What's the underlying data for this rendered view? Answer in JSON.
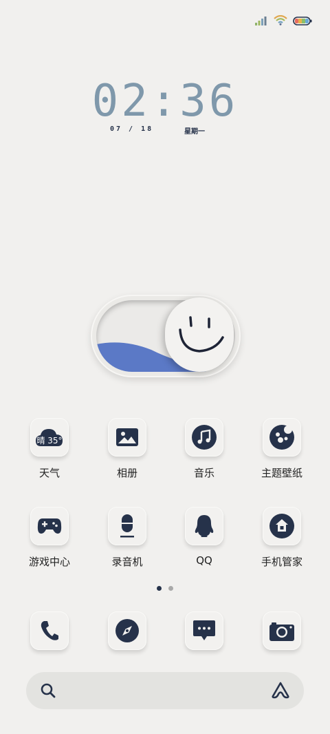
{
  "status_bar": {
    "icons": [
      "signal-icon",
      "wifi-icon",
      "battery-icon"
    ]
  },
  "clock": {
    "time": "02:36",
    "date": "07 / 18",
    "weekday": "星期一"
  },
  "widget": {
    "icons": [
      "smiley-face-icon"
    ],
    "toggle_state": "on",
    "colors": {
      "wave": "#5b79c6",
      "knob": "#f3f2f0"
    }
  },
  "apps_row1": [
    {
      "label": "天气",
      "icon": "weather-cloud-icon",
      "weather_text": "晴 35°"
    },
    {
      "label": "相册",
      "icon": "gallery-image-icon"
    },
    {
      "label": "音乐",
      "icon": "music-note-icon"
    },
    {
      "label": "主题壁纸",
      "icon": "theme-palette-icon"
    }
  ],
  "apps_row2": [
    {
      "label": "游戏中心",
      "icon": "gamepad-icon"
    },
    {
      "label": "录音机",
      "icon": "microphone-icon"
    },
    {
      "label": "QQ",
      "icon": "qq-penguin-icon"
    },
    {
      "label": "手机管家",
      "icon": "phone-manager-icon"
    }
  ],
  "page_indicator": {
    "pages": 2,
    "current": 1
  },
  "dock": [
    {
      "icon": "phone-icon"
    },
    {
      "icon": "compass-browser-icon"
    },
    {
      "icon": "message-icon"
    },
    {
      "icon": "camera-icon"
    }
  ],
  "search_bar": {
    "icons": [
      "search-icon",
      "assistant-icon"
    ]
  },
  "colors": {
    "background": "#f1f0ee",
    "icon_dark": "#26324a",
    "clock": "#7f98ab"
  }
}
